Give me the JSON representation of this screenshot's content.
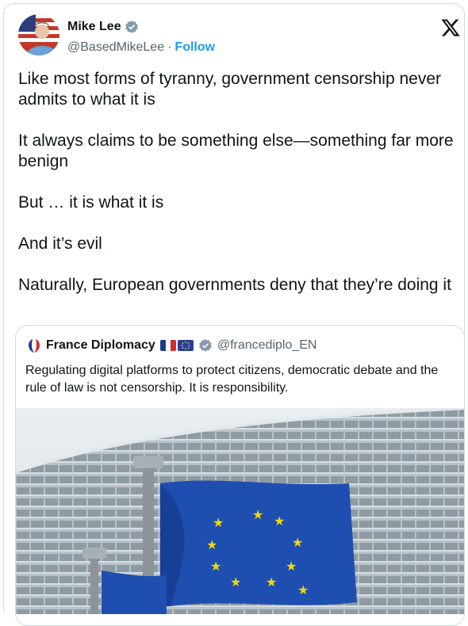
{
  "author": {
    "name": "Mike Lee",
    "handle": "@BasedMikeLee",
    "separator": "·",
    "follow_label": "Follow"
  },
  "tweet": {
    "paragraphs": [
      "Like most forms of tyranny, government censorship never admits to what it is",
      "It always claims to be something else—something far more benign",
      "But … it is what it is",
      "And it’s evil",
      "Naturally, European governments deny that they’re doing it"
    ]
  },
  "quote": {
    "name": "France Diplomacy",
    "handle": "@francediplo_EN",
    "text": "Regulating digital platforms to protect citizens, democratic debate and the rule of law is not censorship. It is responsibility."
  },
  "icons": {
    "verified": "verified-badge-icon",
    "platform": "x-logo-icon",
    "france_flag": "france-flag-icon",
    "eu_flag": "eu-flag-icon"
  },
  "colors": {
    "link": "#1d9bf0",
    "secondary_text": "#536471",
    "border": "#cfd9de",
    "eu_blue": "#2a3d9e",
    "eu_star": "#f5d600"
  }
}
